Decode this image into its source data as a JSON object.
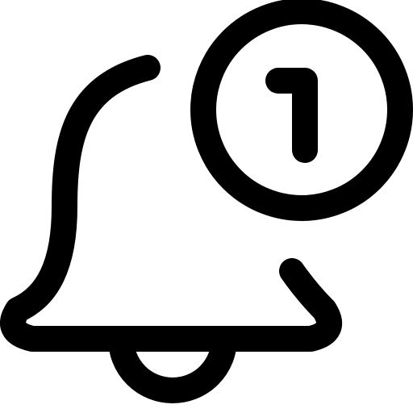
{
  "icon": {
    "name": "notification-bell-icon",
    "color": "#000000",
    "badge": {
      "name": "notification-count-badge",
      "count": "1"
    }
  }
}
